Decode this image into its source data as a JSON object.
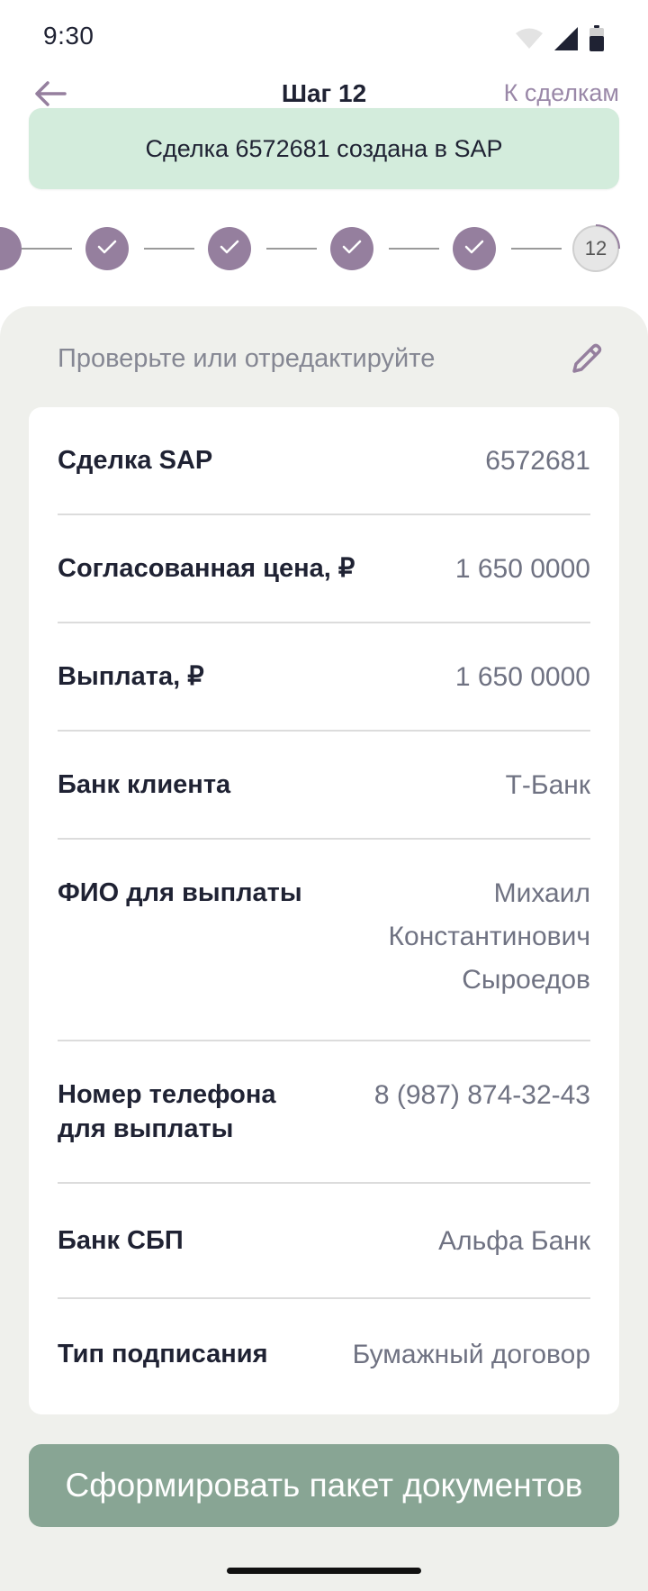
{
  "status_bar": {
    "time": "9:30"
  },
  "header": {
    "title": "Шаг 12",
    "right_link": "К сделкам"
  },
  "toast": {
    "message": "Сделка 6572681 создана в SAP"
  },
  "stepper": {
    "current_step": "12"
  },
  "panel": {
    "hint": "Проверьте или отредактируйте"
  },
  "details": [
    {
      "label": "Сделка SAP",
      "value": "6572681"
    },
    {
      "label": "Согласованная цена, ₽",
      "value": "1 650 0000"
    },
    {
      "label": "Выплата, ₽",
      "value": "1 650 0000"
    },
    {
      "label": "Банк клиента",
      "value": "Т-Банк"
    },
    {
      "label": "ФИО для выплаты",
      "value_lines": [
        "Михаил",
        "Константинович",
        "Сыроедов"
      ]
    },
    {
      "label_lines": [
        "Номер телефона",
        "для выплаты"
      ],
      "value": "8 (987) 874-32-43"
    },
    {
      "label": "Банк СБП",
      "value": "Альфа Банк"
    },
    {
      "label": "Тип подписания",
      "value": "Бумажный договор"
    }
  ],
  "actions": {
    "primary_label": "Сформировать пакет документов"
  },
  "colors": {
    "accent": "#957f9e",
    "toast_bg": "#d3ecdc",
    "panel_bg": "#eff0ec",
    "button_bg": "#88a594"
  }
}
